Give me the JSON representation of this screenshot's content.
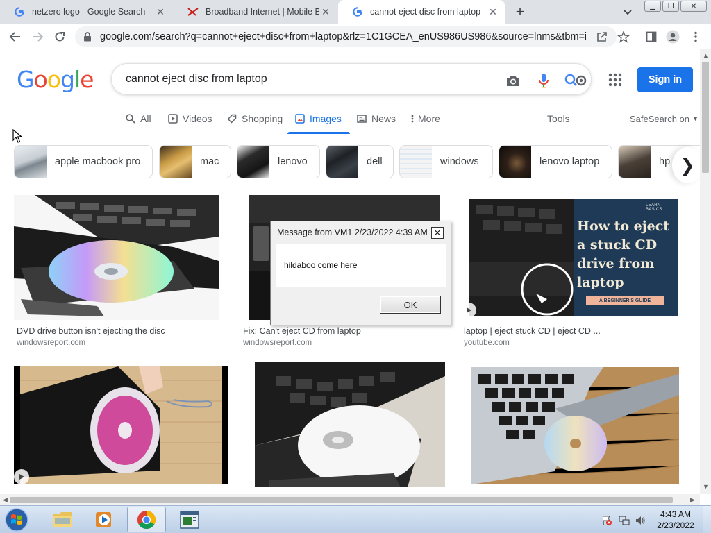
{
  "browser": {
    "tabs": [
      {
        "title": "netzero logo - Google Search",
        "favicon": "google-g-icon"
      },
      {
        "title": "Broadband Internet | Mobile Broadband",
        "favicon": "netzero-icon"
      },
      {
        "title": "cannot eject disc from laptop - Google Search",
        "favicon": "google-g-icon",
        "active": true
      }
    ],
    "url_host": "google.com",
    "url_path": "/search?q=cannot+eject+disc+from+laptop&rlz=1C1GCEA_enUS986US986&source=lnms&tbm=isc..."
  },
  "google": {
    "logo_letters": [
      "G",
      "o",
      "o",
      "g",
      "l",
      "e"
    ],
    "logo_colors": [
      "#4285F4",
      "#EA4335",
      "#FBBC05",
      "#4285F4",
      "#34A853",
      "#EA4335"
    ],
    "query": "cannot eject disc from laptop",
    "sign_in_label": "Sign in",
    "tabs": [
      {
        "label": "All",
        "icon": "search-icon"
      },
      {
        "label": "Videos",
        "icon": "video-icon"
      },
      {
        "label": "Shopping",
        "icon": "tag-icon"
      },
      {
        "label": "Images",
        "icon": "image-icon",
        "active": true
      },
      {
        "label": "News",
        "icon": "news-icon"
      },
      {
        "label": "More",
        "icon": "more-vert-icon"
      }
    ],
    "tools_label": "Tools",
    "safesearch_label": "SafeSearch on"
  },
  "chips": [
    "apple macbook pro",
    "mac",
    "lenovo",
    "dell",
    "windows",
    "lenovo laptop",
    "hp p"
  ],
  "results": [
    {
      "title": "DVD drive button isn't ejecting the disc",
      "site": "windowsreport.com"
    },
    {
      "title": "Fix: Can't eject CD from laptop",
      "site": "windowsreport.com"
    },
    {
      "title": "laptop | eject stuck CD | eject CD ...",
      "site": "youtube.com"
    }
  ],
  "thumb_text": {
    "learn_basics": "LEARN BASICS",
    "headline_lines": [
      "How to eject",
      "a stuck CD",
      "drive from",
      "laptop"
    ],
    "badge": "A BEGINNER'S GUIDE"
  },
  "dialog": {
    "title": "Message from VM1 2/23/2022 4:39 AM",
    "message": "hildaboo come here",
    "ok_label": "OK"
  },
  "taskbar": {
    "time": "4:43 AM",
    "date": "2/23/2022",
    "colors": {
      "accent": "#1a73e8",
      "taskbar": "#c9d9ee"
    }
  }
}
